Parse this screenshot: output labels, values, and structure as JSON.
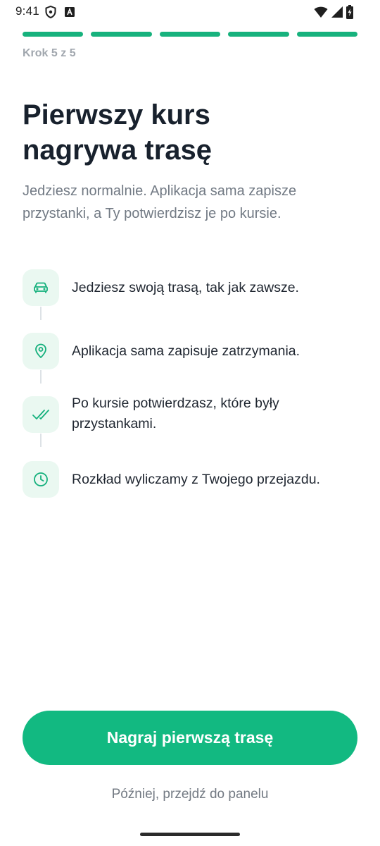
{
  "status_bar": {
    "time": "9:41",
    "icons": [
      "shield-icon",
      "font-a-icon",
      "wifi-icon",
      "cell-signal-icon",
      "battery-charging-icon"
    ]
  },
  "progress": {
    "total_steps": 5,
    "completed_steps": 5,
    "label": "Krok 5 z 5",
    "accent": "#17b27d"
  },
  "heading": {
    "title_line1": "Pierwszy kurs",
    "title_line2": "nagrywa trasę",
    "subtitle": "Jedziesz normalnie. Aplikacja sama zapisze przystanki, a Ty potwierdzisz je po kursie."
  },
  "steps": [
    {
      "icon": "car-icon",
      "text": "Jedziesz swoją trasą, tak jak zawsze."
    },
    {
      "icon": "map-pin-icon",
      "text": "Aplikacja sama zapisuje zatrzymania."
    },
    {
      "icon": "double-check-icon",
      "text": "Po kursie potwierdzasz, które były przystankami."
    },
    {
      "icon": "clock-icon",
      "text": "Rozkład wyliczamy z Twojego przejazdu."
    }
  ],
  "actions": {
    "primary_label": "Nagraj pierwszą trasę",
    "secondary_label": "Później, przejdź do panelu"
  },
  "colors": {
    "accent": "#12b981",
    "icon_bg": "#eaf8f1",
    "text_muted": "#727a84"
  }
}
